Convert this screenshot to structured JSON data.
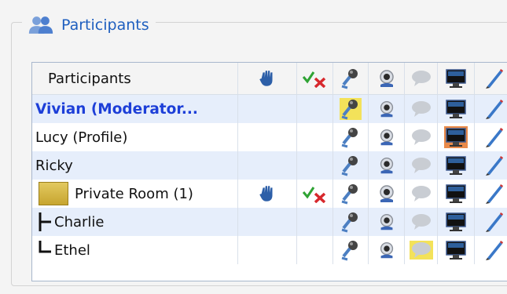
{
  "group": {
    "title": "Participants",
    "icon": "users-icon"
  },
  "table": {
    "header": {
      "participants_label": "Participants",
      "icons": [
        "raise-hand-icon",
        "agree-disagree-icon",
        "microphone-icon",
        "webcam-icon",
        "chat-icon",
        "screen-share-icon",
        "annotation-pen-icon"
      ]
    },
    "rows": [
      {
        "name": "Vivian (Moderator...",
        "role": "moderator",
        "highlight": "microphone"
      },
      {
        "name": "Lucy (Profile)",
        "role": "participant",
        "highlight": "screen-share"
      },
      {
        "name": "Ricky",
        "role": "participant"
      },
      {
        "name": "Private Room (1)",
        "role": "breakout-room",
        "raised_hand": true,
        "agree_disagree": true
      },
      {
        "name": "Charlie",
        "role": "room-member"
      },
      {
        "name": "Ethel",
        "role": "room-member",
        "highlight": "chat"
      }
    ]
  },
  "colors": {
    "title_blue": "#1f5fbf",
    "moderator_blue": "#1d3fd8",
    "row_alt": "#e6eefb",
    "highlight": "#f3e25a"
  }
}
